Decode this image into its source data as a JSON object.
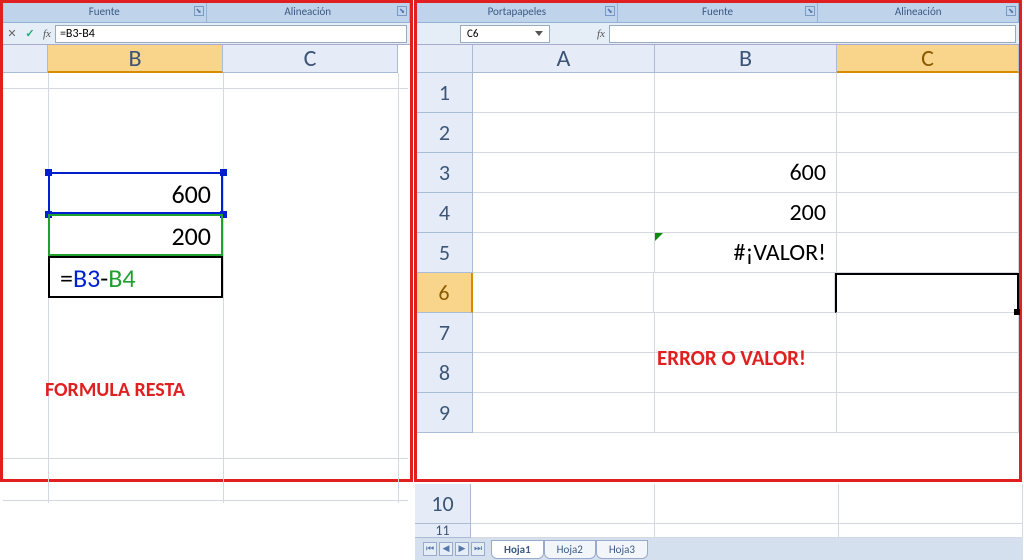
{
  "left": {
    "ribbon": {
      "fuente": "Fuente",
      "alineacion": "Alineación"
    },
    "formula_bar": {
      "formula": "=B3-B4"
    },
    "cols": {
      "b": "B",
      "c": "C"
    },
    "cells": {
      "b3": "600",
      "b4": "200",
      "b5_eq": "=",
      "b5_ref1": "B3",
      "b5_op": "-",
      "b5_ref2": "B4"
    },
    "caption": "FORMULA RESTA"
  },
  "right": {
    "ribbon": {
      "portapapeles": "Portapapeles",
      "fuente": "Fuente",
      "alineacion": "Alineación"
    },
    "formula_bar": {
      "namebox": "C6",
      "formula": ""
    },
    "cols": {
      "a": "A",
      "b": "B",
      "c": "C"
    },
    "rows": [
      "1",
      "2",
      "3",
      "4",
      "5",
      "6",
      "7",
      "8",
      "9",
      "10",
      "11"
    ],
    "cells": {
      "b3": "600",
      "b4": "200",
      "b5": "#¡VALOR!"
    },
    "error_caption": "ERROR O  VALOR!",
    "sheet_tabs": [
      "Hoja1",
      "Hoja2",
      "Hoja3"
    ]
  }
}
